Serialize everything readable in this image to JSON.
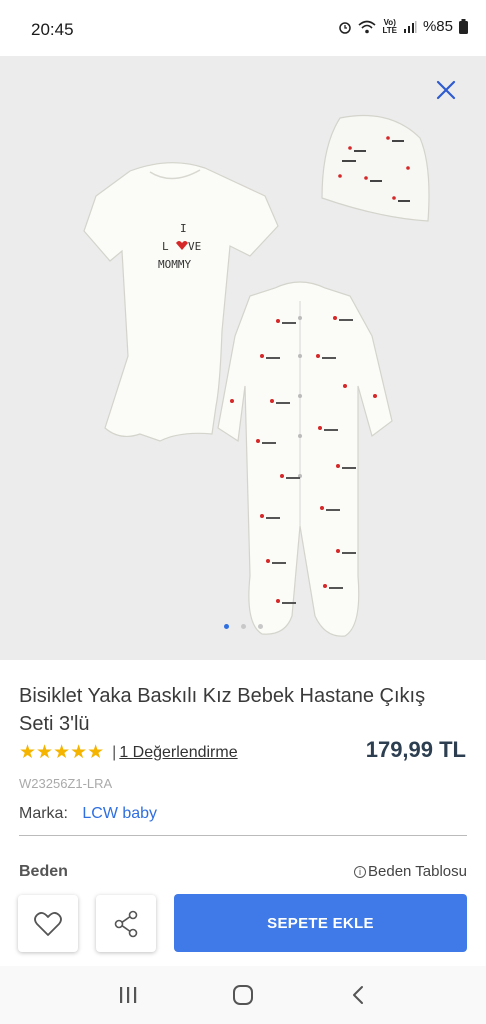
{
  "status": {
    "time": "20:45",
    "battery": "%85",
    "network": "Vo) LTE"
  },
  "gallery": {
    "bodysuit_print": [
      "I",
      "L",
      "VE",
      "MOMMY"
    ],
    "active_dot": 0
  },
  "product": {
    "title": "Bisiklet Yaka Baskılı Kız Bebek Hastane Çıkış Seti 3'lü",
    "stars": "★★★★★",
    "separator": "|",
    "reviews": "1 Değerlendirme",
    "price": "179,99 TL",
    "sku": "W23256Z1-LRA",
    "brand_label": "Marka:",
    "brand_value": "LCW baby"
  },
  "size": {
    "label": "Beden",
    "table_link": "Beden Tablosu",
    "info_glyph": "i"
  },
  "actions": {
    "add_to_cart": "SEPETE EKLE"
  },
  "colors": {
    "accent": "#3f7ae8",
    "star": "#f5b400",
    "gallery_bg": "#ececec"
  }
}
